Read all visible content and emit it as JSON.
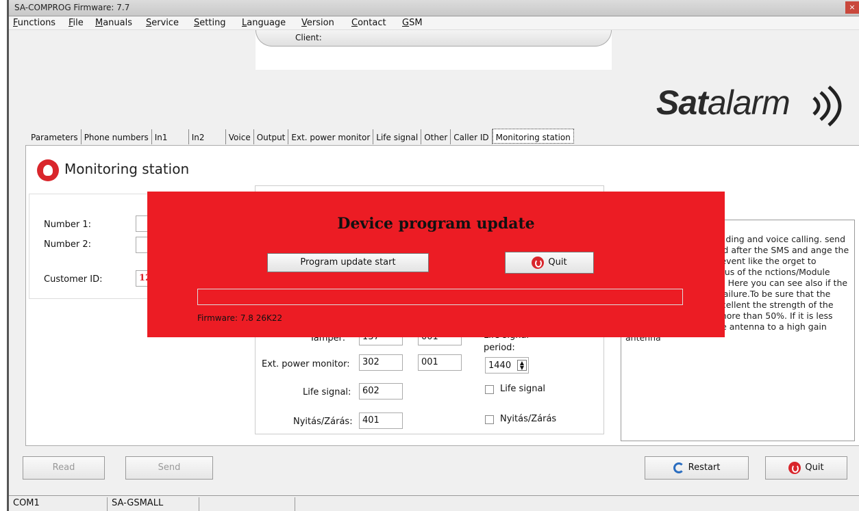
{
  "window": {
    "title": "SA-COMPROG Firmware: 7.7",
    "close": "×"
  },
  "menu": [
    "Functions",
    "File",
    "Manuals",
    "Service",
    "Setting",
    "Language",
    "Version",
    "Contact",
    "GSM"
  ],
  "client": {
    "label": "Client:"
  },
  "logo": {
    "text_bold": "Sat",
    "text_light": "alarm"
  },
  "tabs": [
    "Parameters",
    "Phone numbers",
    "In1",
    "In2",
    "Voice",
    "Output",
    "Ext. power monitor",
    "Life signal",
    "Other",
    "Caller ID",
    "Monitoring station"
  ],
  "panel": {
    "title": "Monitoring station",
    "number1_label": "Number 1:",
    "number2_label": "Number 2:",
    "customer_id_label": "Customer ID:",
    "customer_id_value": "12",
    "tamper_label": "Tamper:",
    "tamper_code": "137",
    "tamper_code2": "001",
    "ext_power_label": "Ext. power monitor:",
    "ext_power_code": "302",
    "ext_power_code2": "001",
    "life_signal_label": "Life signal:",
    "life_signal_code": "602",
    "nyitas_label": "Nyitás/Zárás:",
    "nyitas_code": "401",
    "life_period_label1": "Life signal",
    "life_period_label2": "period:",
    "life_period_value": "1440",
    "chk_life_signal": "Life signal",
    "chk_nyitas": "Nyitás/Zárás",
    "info_text": "otification can be used ding and voice calling. send the Contact-ID to st and after the SMS and ange the Contact-ID d different event like the orget to change the ow the status of the nctions/Module status: Error code/CID : Here you can see also if the communication has a failure.To be sure that the communication will excellent the strength of the GSM signal has to be more than 50%. If it is less than please change the antenna to a high gain antenna"
  },
  "dialog": {
    "title": "Device program update",
    "start_button": "Program update start",
    "quit_button": "Quit",
    "firmware": "Firmware: 7.8 26K22"
  },
  "buttons": {
    "read": "Read",
    "send": "Send",
    "restart": "Restart",
    "quit": "Quit"
  },
  "status": {
    "port": "COM1",
    "device": "SA-GSMALL"
  }
}
